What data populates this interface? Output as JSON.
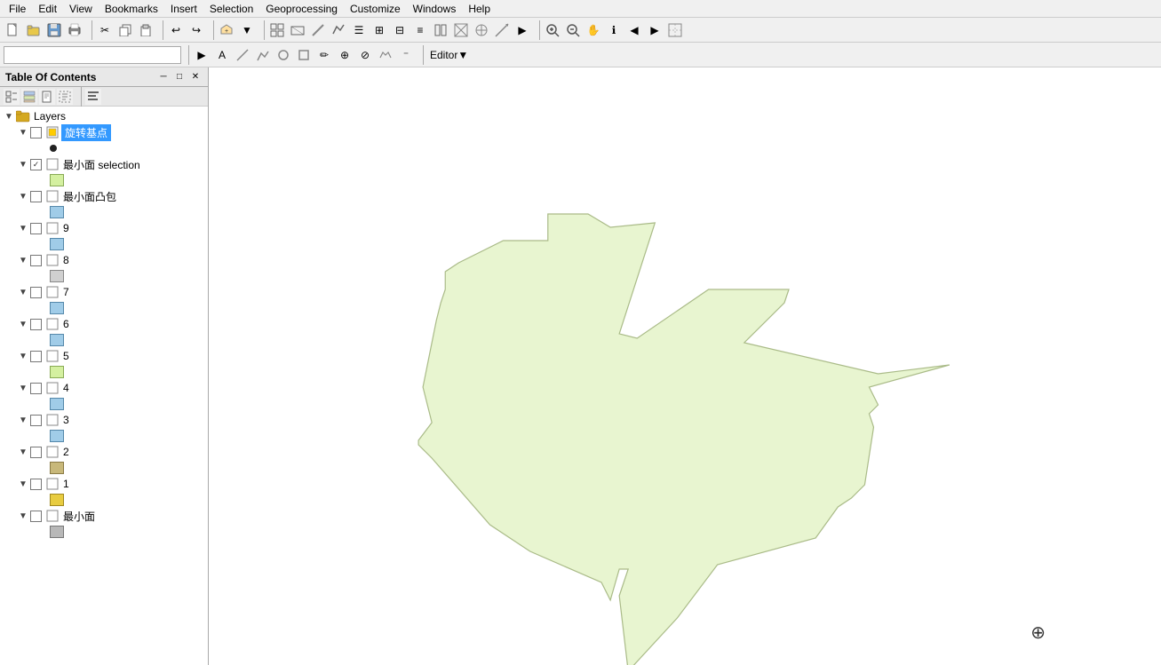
{
  "menubar": {
    "items": [
      "File",
      "Edit",
      "View",
      "Bookmarks",
      "Insert",
      "Selection",
      "Geoprocessing",
      "Customize",
      "Windows",
      "Help"
    ]
  },
  "toolbar1": {
    "combo_value": "",
    "combo_placeholder": "",
    "editor_label": "Editor▼"
  },
  "toc": {
    "title": "Table Of Contents",
    "layers_label": "Layers",
    "items": [
      {
        "id": "旋转基点",
        "label": "旋转基点",
        "level": 1,
        "type": "feature",
        "selected": true,
        "expanded": true,
        "checked": false
      },
      {
        "id": "dot",
        "label": "",
        "level": 2,
        "type": "dot"
      },
      {
        "id": "最小面selection",
        "label": "最小面 selection",
        "level": 1,
        "type": "feature",
        "checked": true,
        "expanded": false
      },
      {
        "id": "sym_sel",
        "label": "",
        "level": 2,
        "type": "sym_green_light"
      },
      {
        "id": "最小面凸包",
        "label": "最小面凸包",
        "level": 1,
        "type": "feature",
        "checked": false,
        "expanded": false
      },
      {
        "id": "sym_tutu",
        "label": "",
        "level": 2,
        "type": "sym_blue_light"
      },
      {
        "id": "9",
        "label": "9",
        "level": 1,
        "type": "feature",
        "checked": false
      },
      {
        "id": "sym_9",
        "label": "",
        "level": 2,
        "type": "sym_blue_light"
      },
      {
        "id": "8",
        "label": "8",
        "level": 1,
        "type": "feature",
        "checked": false
      },
      {
        "id": "sym_8",
        "label": "",
        "level": 2,
        "type": "sym_gray_light"
      },
      {
        "id": "7",
        "label": "7",
        "level": 1,
        "type": "feature",
        "checked": false
      },
      {
        "id": "sym_7",
        "label": "",
        "level": 2,
        "type": "sym_blue_light"
      },
      {
        "id": "6",
        "label": "6",
        "level": 1,
        "type": "feature",
        "checked": false
      },
      {
        "id": "sym_6",
        "label": "",
        "level": 2,
        "type": "sym_blue_light"
      },
      {
        "id": "5",
        "label": "5",
        "level": 1,
        "type": "feature",
        "checked": false
      },
      {
        "id": "sym_5",
        "label": "",
        "level": 2,
        "type": "sym_green_light"
      },
      {
        "id": "4",
        "label": "4",
        "level": 1,
        "type": "feature",
        "checked": false
      },
      {
        "id": "sym_4",
        "label": "",
        "level": 2,
        "type": "sym_blue_light"
      },
      {
        "id": "3",
        "label": "3",
        "level": 1,
        "type": "feature",
        "checked": false
      },
      {
        "id": "sym_3",
        "label": "",
        "level": 2,
        "type": "sym_blue_light"
      },
      {
        "id": "2",
        "label": "2",
        "level": 1,
        "type": "feature",
        "checked": false
      },
      {
        "id": "sym_2",
        "label": "",
        "level": 2,
        "type": "sym_tan"
      },
      {
        "id": "1",
        "label": "1",
        "level": 1,
        "type": "feature",
        "checked": false
      },
      {
        "id": "sym_1",
        "label": "",
        "level": 2,
        "type": "sym_yellow"
      },
      {
        "id": "最小面",
        "label": "最小面",
        "level": 1,
        "type": "feature",
        "checked": false
      },
      {
        "id": "sym_zxm",
        "label": "",
        "level": 2,
        "type": "sym_gray_medium"
      }
    ]
  },
  "map": {
    "bg_color": "#ffffff",
    "shape_color": "#e8f5d0",
    "shape_border": "#aabb88"
  },
  "toolbar_icons": {
    "new": "📄",
    "open": "📂",
    "save": "💾",
    "print": "🖨",
    "cut": "✂",
    "copy": "📋",
    "paste": "📌",
    "undo": "↩",
    "redo": "↪",
    "zoom_in": "🔍",
    "zoom_out": "🔎",
    "pan": "✋",
    "identify": "ℹ",
    "zoom_extent": "⊡"
  },
  "symbols": {
    "green_light": "#d4f0a0",
    "blue_light": "#a0d0f0",
    "gray_light": "#d0d0d0",
    "tan": "#c8b87a",
    "yellow": "#e8cc40",
    "gray_medium": "#b0b0b0"
  }
}
